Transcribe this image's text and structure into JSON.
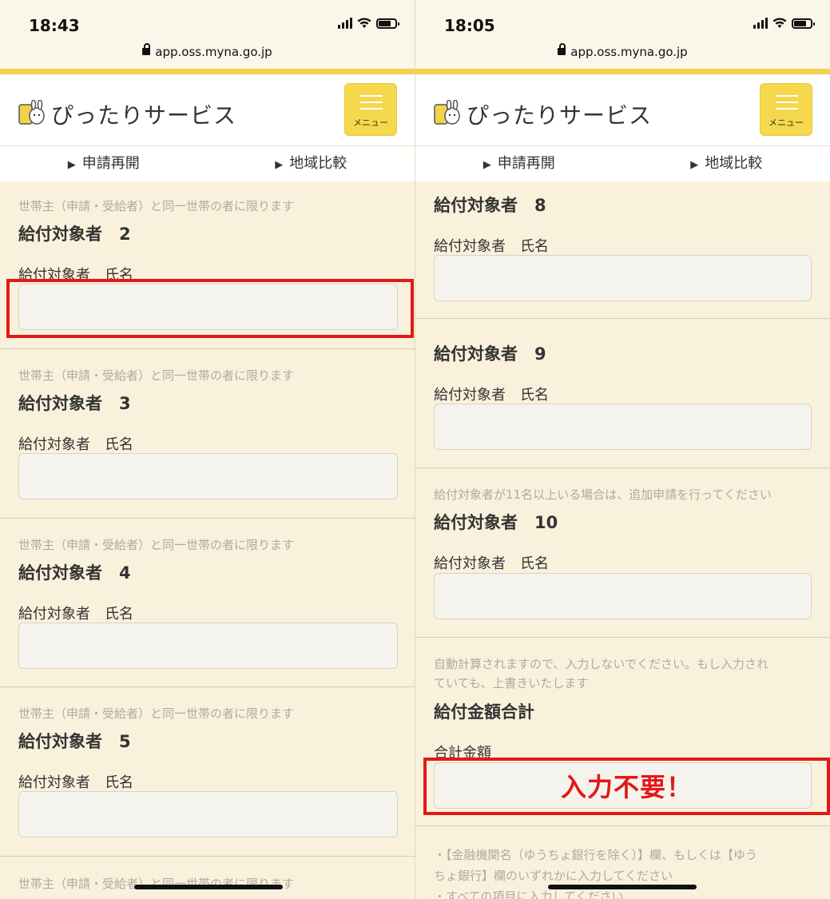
{
  "left": {
    "time": "18:43",
    "url": "app.oss.myna.go.jp",
    "app_title": "ぴったりサービス",
    "menu_label": "メニュー",
    "nav": [
      "申請再開",
      "地域比較"
    ],
    "sections": [
      {
        "note": "世帯主（申請・受給者）と同一世帯の者に限ります",
        "title": "給付対象者　2",
        "field_label": "給付対象者　氏名",
        "value": ""
      },
      {
        "note": "世帯主（申請・受給者）と同一世帯の者に限ります",
        "title": "給付対象者　3",
        "field_label": "給付対象者　氏名",
        "value": ""
      },
      {
        "note": "世帯主（申請・受給者）と同一世帯の者に限ります",
        "title": "給付対象者　4",
        "field_label": "給付対象者　氏名",
        "value": ""
      },
      {
        "note": "世帯主（申請・受給者）と同一世帯の者に限ります",
        "title": "給付対象者　5",
        "field_label": "給付対象者　氏名",
        "value": ""
      }
    ],
    "trailing_note": "世帯主（申請・受給者）と同一世帯の者に限ります"
  },
  "right": {
    "time": "18:05",
    "url": "app.oss.myna.go.jp",
    "app_title": "ぴったりサービス",
    "menu_label": "メニュー",
    "nav": [
      "申請再開",
      "地域比較"
    ],
    "sections": [
      {
        "title": "給付対象者　8",
        "field_label": "給付対象者　氏名",
        "value": ""
      },
      {
        "title": "給付対象者　9",
        "field_label": "給付対象者　氏名",
        "value": ""
      },
      {
        "note": "給付対象者が11名以上いる場合は、追加申請を行ってください",
        "title": "給付対象者　10",
        "field_label": "給付対象者　氏名",
        "value": ""
      }
    ],
    "total": {
      "note_line1": "自動計算されますので、入力しないでください。もし入力され",
      "note_line2": "ていても、上書きいたします",
      "title": "給付金額合計",
      "field_label": "合計金額",
      "annotation": "入力不要！"
    },
    "bank_note_line1": "・【金融機関名（ゆうちょ銀行を除く）】欄、もしくは【ゆう",
    "bank_note_line2": "ちょ銀行】欄のいずれかに入力してください",
    "bank_note_line3": "・すべての項目に入力してください"
  },
  "colors": {
    "accent_yellow": "#f3d24b",
    "highlight_red": "#e31818",
    "background": "#faf1dc"
  }
}
